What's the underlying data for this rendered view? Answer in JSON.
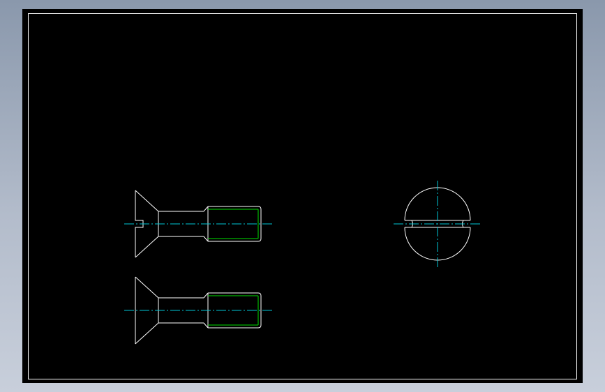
{
  "colors": {
    "background": "#000000",
    "outline": "#ffffff",
    "thread": "#00e000",
    "centerline": "#00c8d8",
    "viewport_frame": "#8a98ac"
  },
  "views": [
    {
      "id": "front-view-sectioned",
      "description_name": "countersunk-slotted-screw-front-view-with-slot"
    },
    {
      "id": "front-view",
      "description_name": "countersunk-screw-front-view"
    },
    {
      "id": "end-view",
      "description_name": "slotted-head-end-view"
    }
  ]
}
